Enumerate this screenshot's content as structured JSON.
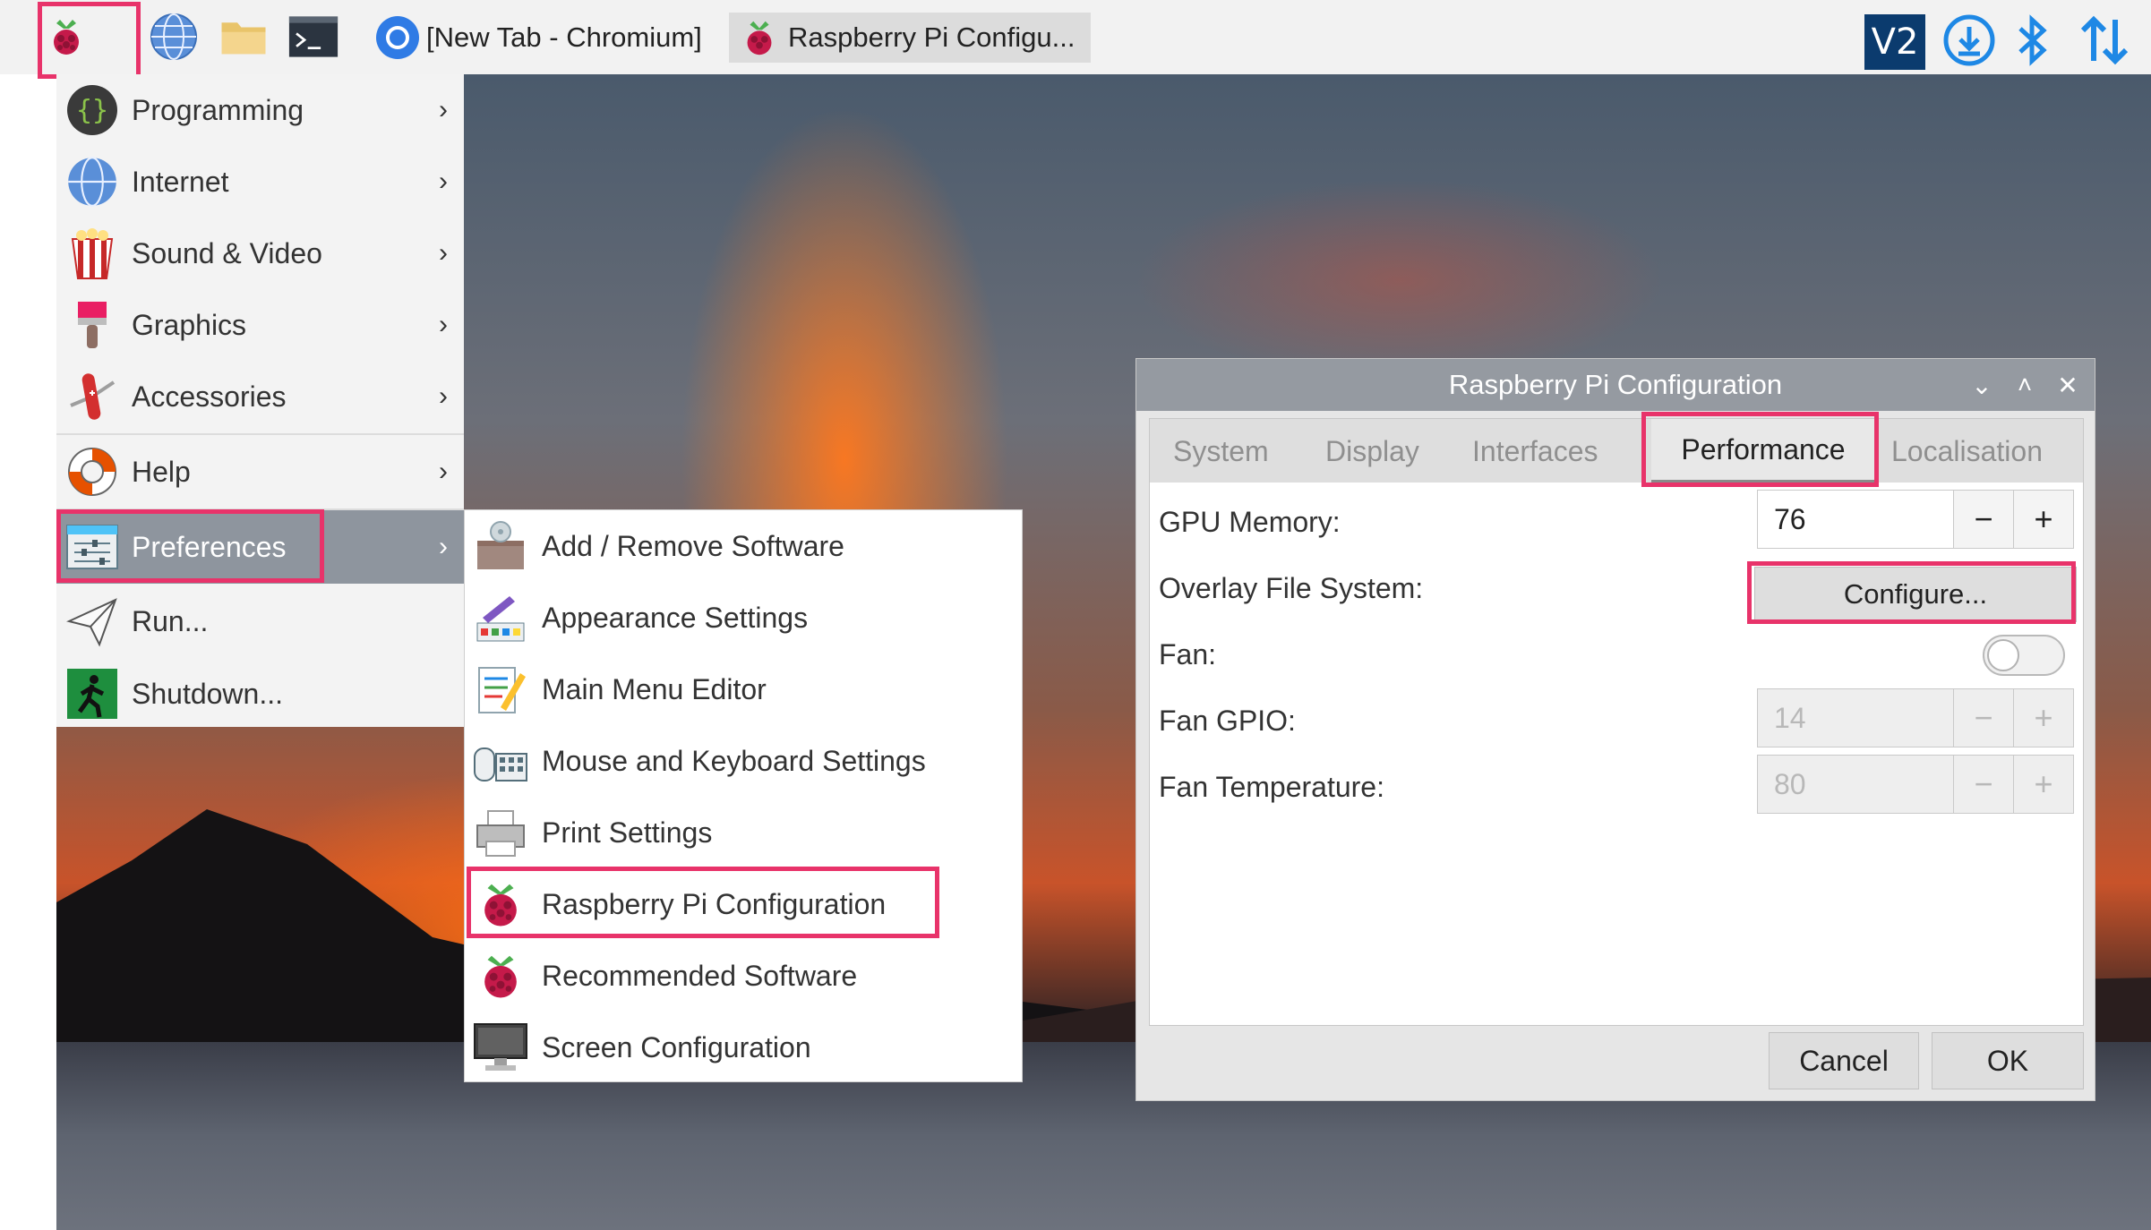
{
  "taskbar": {
    "tasks": [
      {
        "label": "[New Tab - Chromium]",
        "icon": "chromium-icon"
      },
      {
        "label": "Raspberry Pi Configu...",
        "icon": "raspberry-icon"
      }
    ],
    "tray": [
      "vnc-icon",
      "update-download-icon",
      "bluetooth-icon",
      "network-arrows-icon"
    ]
  },
  "main_menu": {
    "items": [
      {
        "label": "Programming",
        "icon": "programming-icon",
        "has_submenu": true
      },
      {
        "label": "Internet",
        "icon": "globe-icon",
        "has_submenu": true
      },
      {
        "label": "Sound & Video",
        "icon": "popcorn-icon",
        "has_submenu": true
      },
      {
        "label": "Graphics",
        "icon": "paintbrush-icon",
        "has_submenu": true
      },
      {
        "label": "Accessories",
        "icon": "pocketknife-icon",
        "has_submenu": true
      },
      {
        "label": "Help",
        "icon": "lifebuoy-icon",
        "has_submenu": true
      },
      {
        "label": "Preferences",
        "icon": "preferences-icon",
        "has_submenu": true,
        "selected": true
      },
      {
        "label": "Run...",
        "icon": "paper-plane-icon",
        "has_submenu": false
      },
      {
        "label": "Shutdown...",
        "icon": "exit-icon",
        "has_submenu": false
      }
    ],
    "arrow": "›"
  },
  "preferences_submenu": {
    "items": [
      {
        "label": "Add / Remove Software",
        "icon": "package-icon"
      },
      {
        "label": "Appearance Settings",
        "icon": "palette-icon"
      },
      {
        "label": "Main Menu Editor",
        "icon": "menu-editor-icon"
      },
      {
        "label": "Mouse and Keyboard Settings",
        "icon": "keyboard-mouse-icon"
      },
      {
        "label": "Print Settings",
        "icon": "printer-icon"
      },
      {
        "label": "Raspberry Pi Configuration",
        "icon": "raspberry-icon"
      },
      {
        "label": "Recommended Software",
        "icon": "raspberry-icon"
      },
      {
        "label": "Screen Configuration",
        "icon": "monitor-icon"
      }
    ]
  },
  "config_dialog": {
    "title": "Raspberry Pi Configuration",
    "controls": {
      "minimize": "⌄",
      "maximize": "˄",
      "close": "✕"
    },
    "tabs": [
      "System",
      "Display",
      "Interfaces",
      "Performance",
      "Localisation"
    ],
    "active_tab": "Performance",
    "gpu_memory": {
      "label": "GPU Memory:",
      "value": "76"
    },
    "overlay": {
      "label": "Overlay File System:",
      "button": "Configure..."
    },
    "fan": {
      "label": "Fan:",
      "enabled": false
    },
    "fan_gpio": {
      "label": "Fan GPIO:",
      "value": "14"
    },
    "fan_temperature": {
      "label": "Fan Temperature:",
      "value": "80"
    },
    "minus": "−",
    "plus": "+",
    "cancel": "Cancel",
    "ok": "OK"
  },
  "colors": {
    "highlight": "#e8336a",
    "menu_selected": "#8e959e",
    "title_bar": "#959aa1"
  }
}
